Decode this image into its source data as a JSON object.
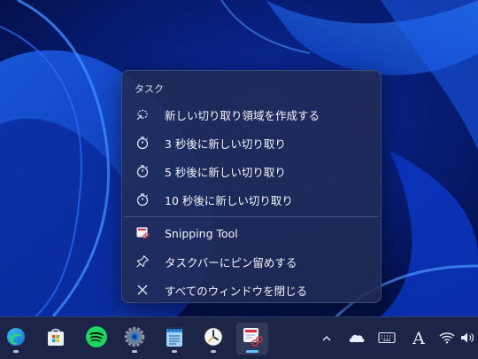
{
  "jumplist": {
    "section_title": "タスク",
    "tasks": [
      {
        "label": "新しい切り取り領域を作成する",
        "icon": "new-snip-icon"
      },
      {
        "label": "3 秒後に新しい切り取り",
        "icon": "timer-icon"
      },
      {
        "label": "5 秒後に新しい切り取り",
        "icon": "timer-icon"
      },
      {
        "label": "10 秒後に新しい切り取り",
        "icon": "timer-icon"
      }
    ],
    "app_items": [
      {
        "label": "Snipping Tool",
        "icon": "snipping-tool-icon"
      },
      {
        "label": "タスクバーにピン留めする",
        "icon": "pin-icon"
      },
      {
        "label": "すべてのウィンドウを閉じる",
        "icon": "close-icon"
      }
    ]
  },
  "taskbar": {
    "apps": [
      {
        "name": "edge-app",
        "icon": "edge-icon"
      },
      {
        "name": "microsoft-store-app",
        "icon": "store-icon"
      },
      {
        "name": "spotify-app",
        "icon": "spotify-icon"
      },
      {
        "name": "settings-app",
        "icon": "gear-icon"
      },
      {
        "name": "notepad-app",
        "icon": "notepad-icon"
      },
      {
        "name": "clock-app",
        "icon": "clock-icon"
      },
      {
        "name": "snipping-tool-app",
        "icon": "snipping-tool-icon",
        "active": true
      }
    ],
    "tray": {
      "ime_indicator": "A",
      "icons": [
        "chevron-up-icon",
        "onedrive-cloud-icon",
        "keyboard-icon",
        "wifi-icon",
        "volume-icon"
      ]
    }
  },
  "colors": {
    "menu_bg": "#212b54",
    "accent": "#5cc3ff",
    "taskbar_bg": "#1c2447"
  }
}
